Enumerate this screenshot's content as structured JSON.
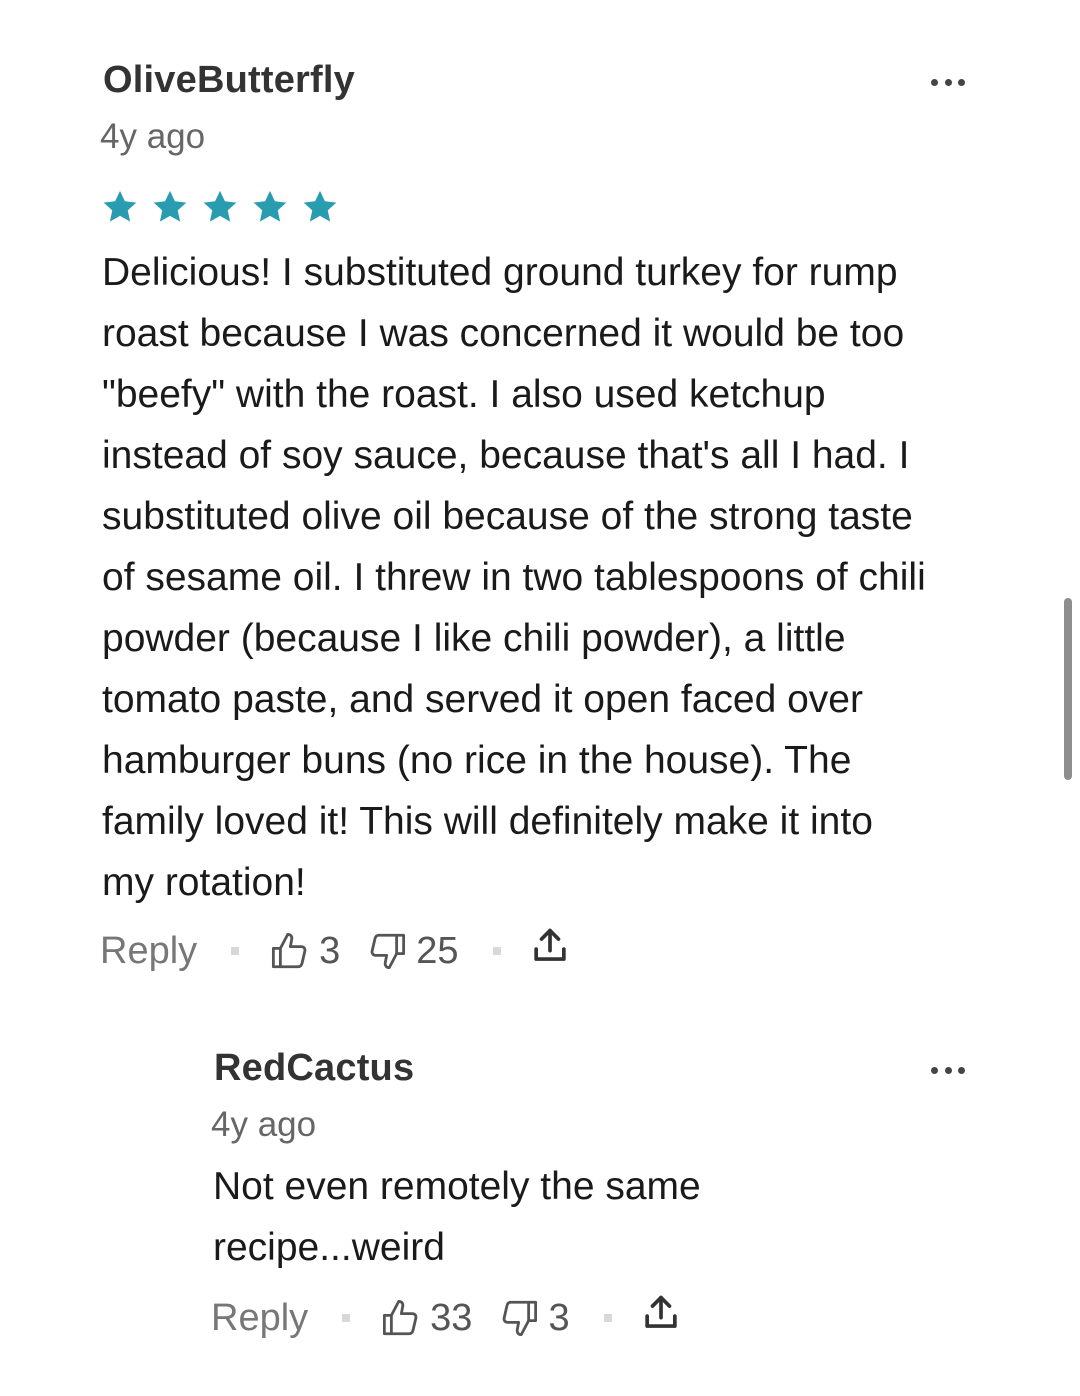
{
  "colors": {
    "star": "#2a9cb0",
    "author": "#333333",
    "meta": "#666666",
    "icon": "#555555"
  },
  "comments": [
    {
      "author": "OliveButterfly",
      "time": "4y ago",
      "rating": 5,
      "text": "Delicious! I substituted ground turkey for rump\nroast because I was concerned it would be too\n\"beefy\" with the roast. I also used ketchup\ninstead of soy sauce, because that's all I had. I\nsubstituted olive oil  because of the strong taste\nof sesame oil. I threw in two tablespoons of chili\npowder (because I like chili powder), a little\ntomato paste, and served it open faced over\nhamburger buns (no rice in the house). The\nfamily loved it! This will definitely make it into\nmy rotation!",
      "reply_label": "Reply",
      "upvotes": "3",
      "downvotes": "25",
      "more_icon": "more-horizontal-icon",
      "upvote_icon": "thumbs-up-icon",
      "downvote_icon": "thumbs-down-icon",
      "share_icon": "share-icon"
    },
    {
      "author": "RedCactus",
      "time": "4y ago",
      "text": "Not even remotely the same\nrecipe...weird",
      "reply_label": "Reply",
      "upvotes": "33",
      "downvotes": "3",
      "more_icon": "more-horizontal-icon",
      "upvote_icon": "thumbs-up-icon",
      "downvote_icon": "thumbs-down-icon",
      "share_icon": "share-icon"
    }
  ]
}
